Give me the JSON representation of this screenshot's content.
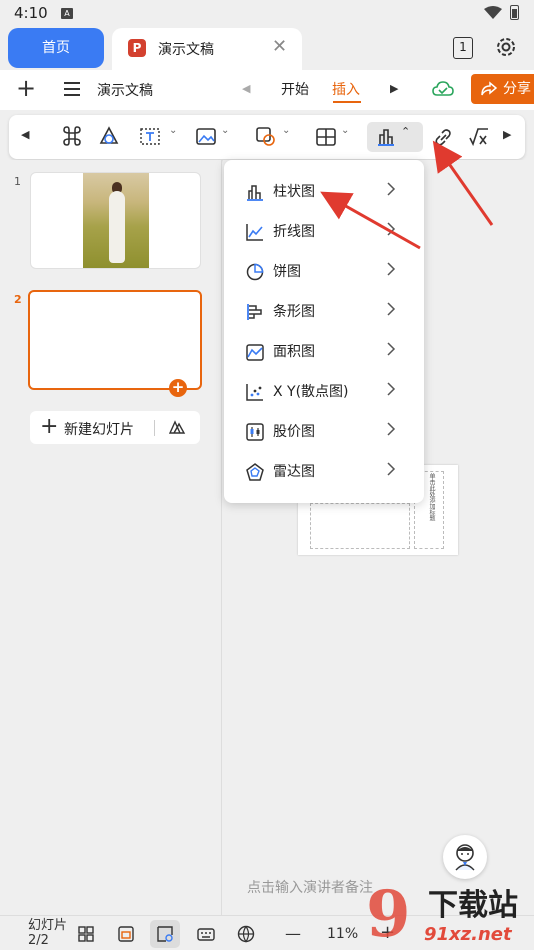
{
  "status_bar": {
    "time": "4:10",
    "notification": "A"
  },
  "tabs": {
    "home_label": "首页",
    "doc_label": "演示文稿",
    "doc_icon_letter": "P",
    "tab_count": "1"
  },
  "toolbar": {
    "doc_title": "演示文稿",
    "tab_start": "开始",
    "tab_insert": "插入",
    "share_label": "分享"
  },
  "ribbon": {
    "icons": [
      "shortcut-icon",
      "shapes-icon",
      "textbox-icon",
      "picture-icon",
      "shape-fill-icon",
      "table-icon",
      "chart-icon",
      "link-icon",
      "formula-icon"
    ]
  },
  "slides": {
    "items": [
      {
        "number": "1"
      },
      {
        "number": "2"
      }
    ],
    "new_slide_label": "新建幻灯片"
  },
  "chart_menu": {
    "items": [
      {
        "label": "柱状图",
        "icon": "column-chart-icon"
      },
      {
        "label": "折线图",
        "icon": "line-chart-icon"
      },
      {
        "label": "饼图",
        "icon": "pie-chart-icon"
      },
      {
        "label": "条形图",
        "icon": "bar-chart-icon"
      },
      {
        "label": "面积图",
        "icon": "area-chart-icon"
      },
      {
        "label": "X Y(散点图)",
        "icon": "scatter-chart-icon"
      },
      {
        "label": "股价图",
        "icon": "stock-chart-icon"
      },
      {
        "label": "雷达图",
        "icon": "radar-chart-icon"
      }
    ]
  },
  "mini_slide": {
    "placeholder": "单击此处添加标题"
  },
  "editor": {
    "notes_hint": "点击输入演讲者备注"
  },
  "bottom_bar": {
    "slide_counter": "幻灯片 2/2",
    "zoom": "11%"
  },
  "watermark": {
    "brand": "下载站",
    "url": "91xz.net",
    "number": "9"
  },
  "colors": {
    "accent": "#e8650e",
    "home_tab": "#3a7bf3",
    "arrow": "#e03a2f"
  }
}
